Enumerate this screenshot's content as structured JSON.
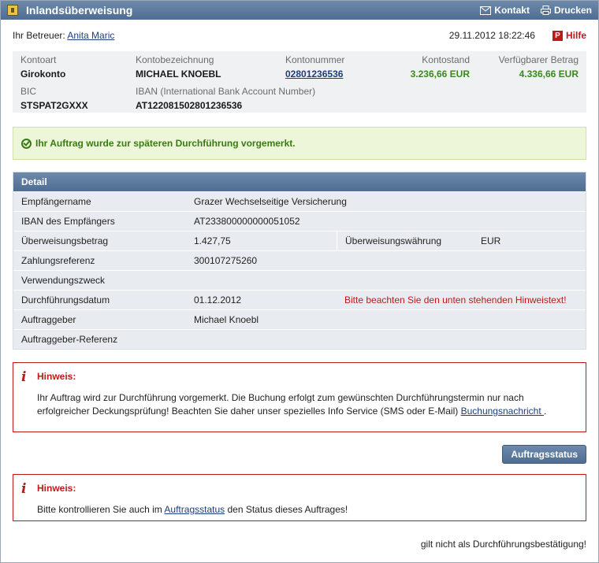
{
  "title": "Inlandsüberweisung",
  "toolbar": {
    "contact_label": "Kontakt",
    "print_label": "Drucken"
  },
  "meta": {
    "advisor_label": "Ihr Betreuer:",
    "advisor_name": "Anita Maric",
    "datetime": "29.11.2012 18:22:46",
    "help_label": "Hilfe"
  },
  "account": {
    "type_label": "Kontoart",
    "type_value": "Girokonto",
    "name_label": "Kontobezeichnung",
    "name_value": "MICHAEL KNOEBL",
    "number_label": "Kontonummer",
    "number_value": "02801236536",
    "balance_label": "Kontostand",
    "balance_value": "3.236,66 EUR",
    "available_label": "Verfügbarer Betrag",
    "available_value": "4.336,66 EUR",
    "bic_label": "BIC",
    "bic_value": "STSPAT2GXXX",
    "iban_label": "IBAN (International Bank Account Number)",
    "iban_value": "AT122081502801236536"
  },
  "success_message": "Ihr Auftrag wurde zur späteren Durchführung vorgemerkt.",
  "detail": {
    "header": "Detail",
    "recipient_label": "Empfängername",
    "recipient_value": "Grazer Wechselseitige Versicherung",
    "iban_label": "IBAN des Empfängers",
    "iban_value": "AT233800000000051052",
    "amount_label": "Überweisungsbetrag",
    "amount_value": "1.427,75",
    "currency_label": "Überweisungswährung",
    "currency_value": "EUR",
    "reference_label": "Zahlungsreferenz",
    "reference_value": "300107275260",
    "purpose_label": "Verwendungszweck",
    "purpose_value": "",
    "date_label": "Durchführungsdatum",
    "date_value": "01.12.2012",
    "date_hint": "Bitte beachten Sie den unten stehenden Hinweistext!",
    "orderer_label": "Auftraggeber",
    "orderer_value": "Michael Knoebl",
    "orderer_ref_label": "Auftraggeber-Referenz",
    "orderer_ref_value": ""
  },
  "hint1": {
    "title": "Hinweis:",
    "text_before": "Ihr Auftrag wird zur Durchführung vorgemerkt. Die Buchung erfolgt zum gewünschten Durchführungstermin nur nach erfolgreicher Deckungsprüfung! Beachten Sie daher unser spezielles Info Service (SMS oder E-Mail) ",
    "link": "Buchungsnachricht ",
    "text_after": "."
  },
  "status_button": "Auftragsstatus",
  "hint2": {
    "title": "Hinweis:",
    "text_before": "Bitte kontrollieren Sie auch im ",
    "link": "Auftragsstatus",
    "text_after": " den Status dieses Auftrages!"
  },
  "footer_note": "gilt nicht als Durchführungsbestätigung!"
}
